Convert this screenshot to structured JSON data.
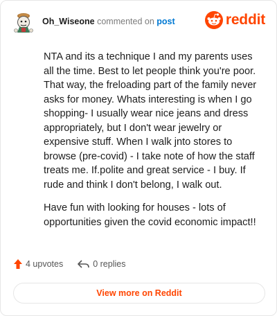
{
  "header": {
    "username": "Oh_Wiseone",
    "commented_text": "commented on",
    "post_link": "post"
  },
  "brand": {
    "wordmark": "reddit",
    "color": "#ff4500"
  },
  "comment": {
    "paragraphs": [
      "NTA and its a technique I and my parents uses all the time. Best to let people think you're poor. That way, the freloading part of the family never asks for money. Whats interesting is when I go shopping- I usually wear nice jeans and dress appropriately, but I don't wear jewelry or expensive stuff. When I walk jnto stores to browse (pre-covid) - I take note of how the staff treats me. If.polite and great service - I buy. If rude and think I don't belong, I walk out.",
      "Have fun with looking for houses - lots of opportunities given the covid economic impact!!"
    ]
  },
  "footer": {
    "upvotes": "4 upvotes",
    "replies": "0 replies",
    "view_button": "View more on Reddit"
  },
  "icons": {
    "upvote": "arrow-up-icon",
    "reply": "reply-arrow-icon",
    "logo": "reddit-snoo-icon",
    "avatar": "snoo-avatar"
  },
  "colors": {
    "accent": "#ff4500",
    "link": "#0079d3",
    "muted": "#7c7c7c"
  }
}
